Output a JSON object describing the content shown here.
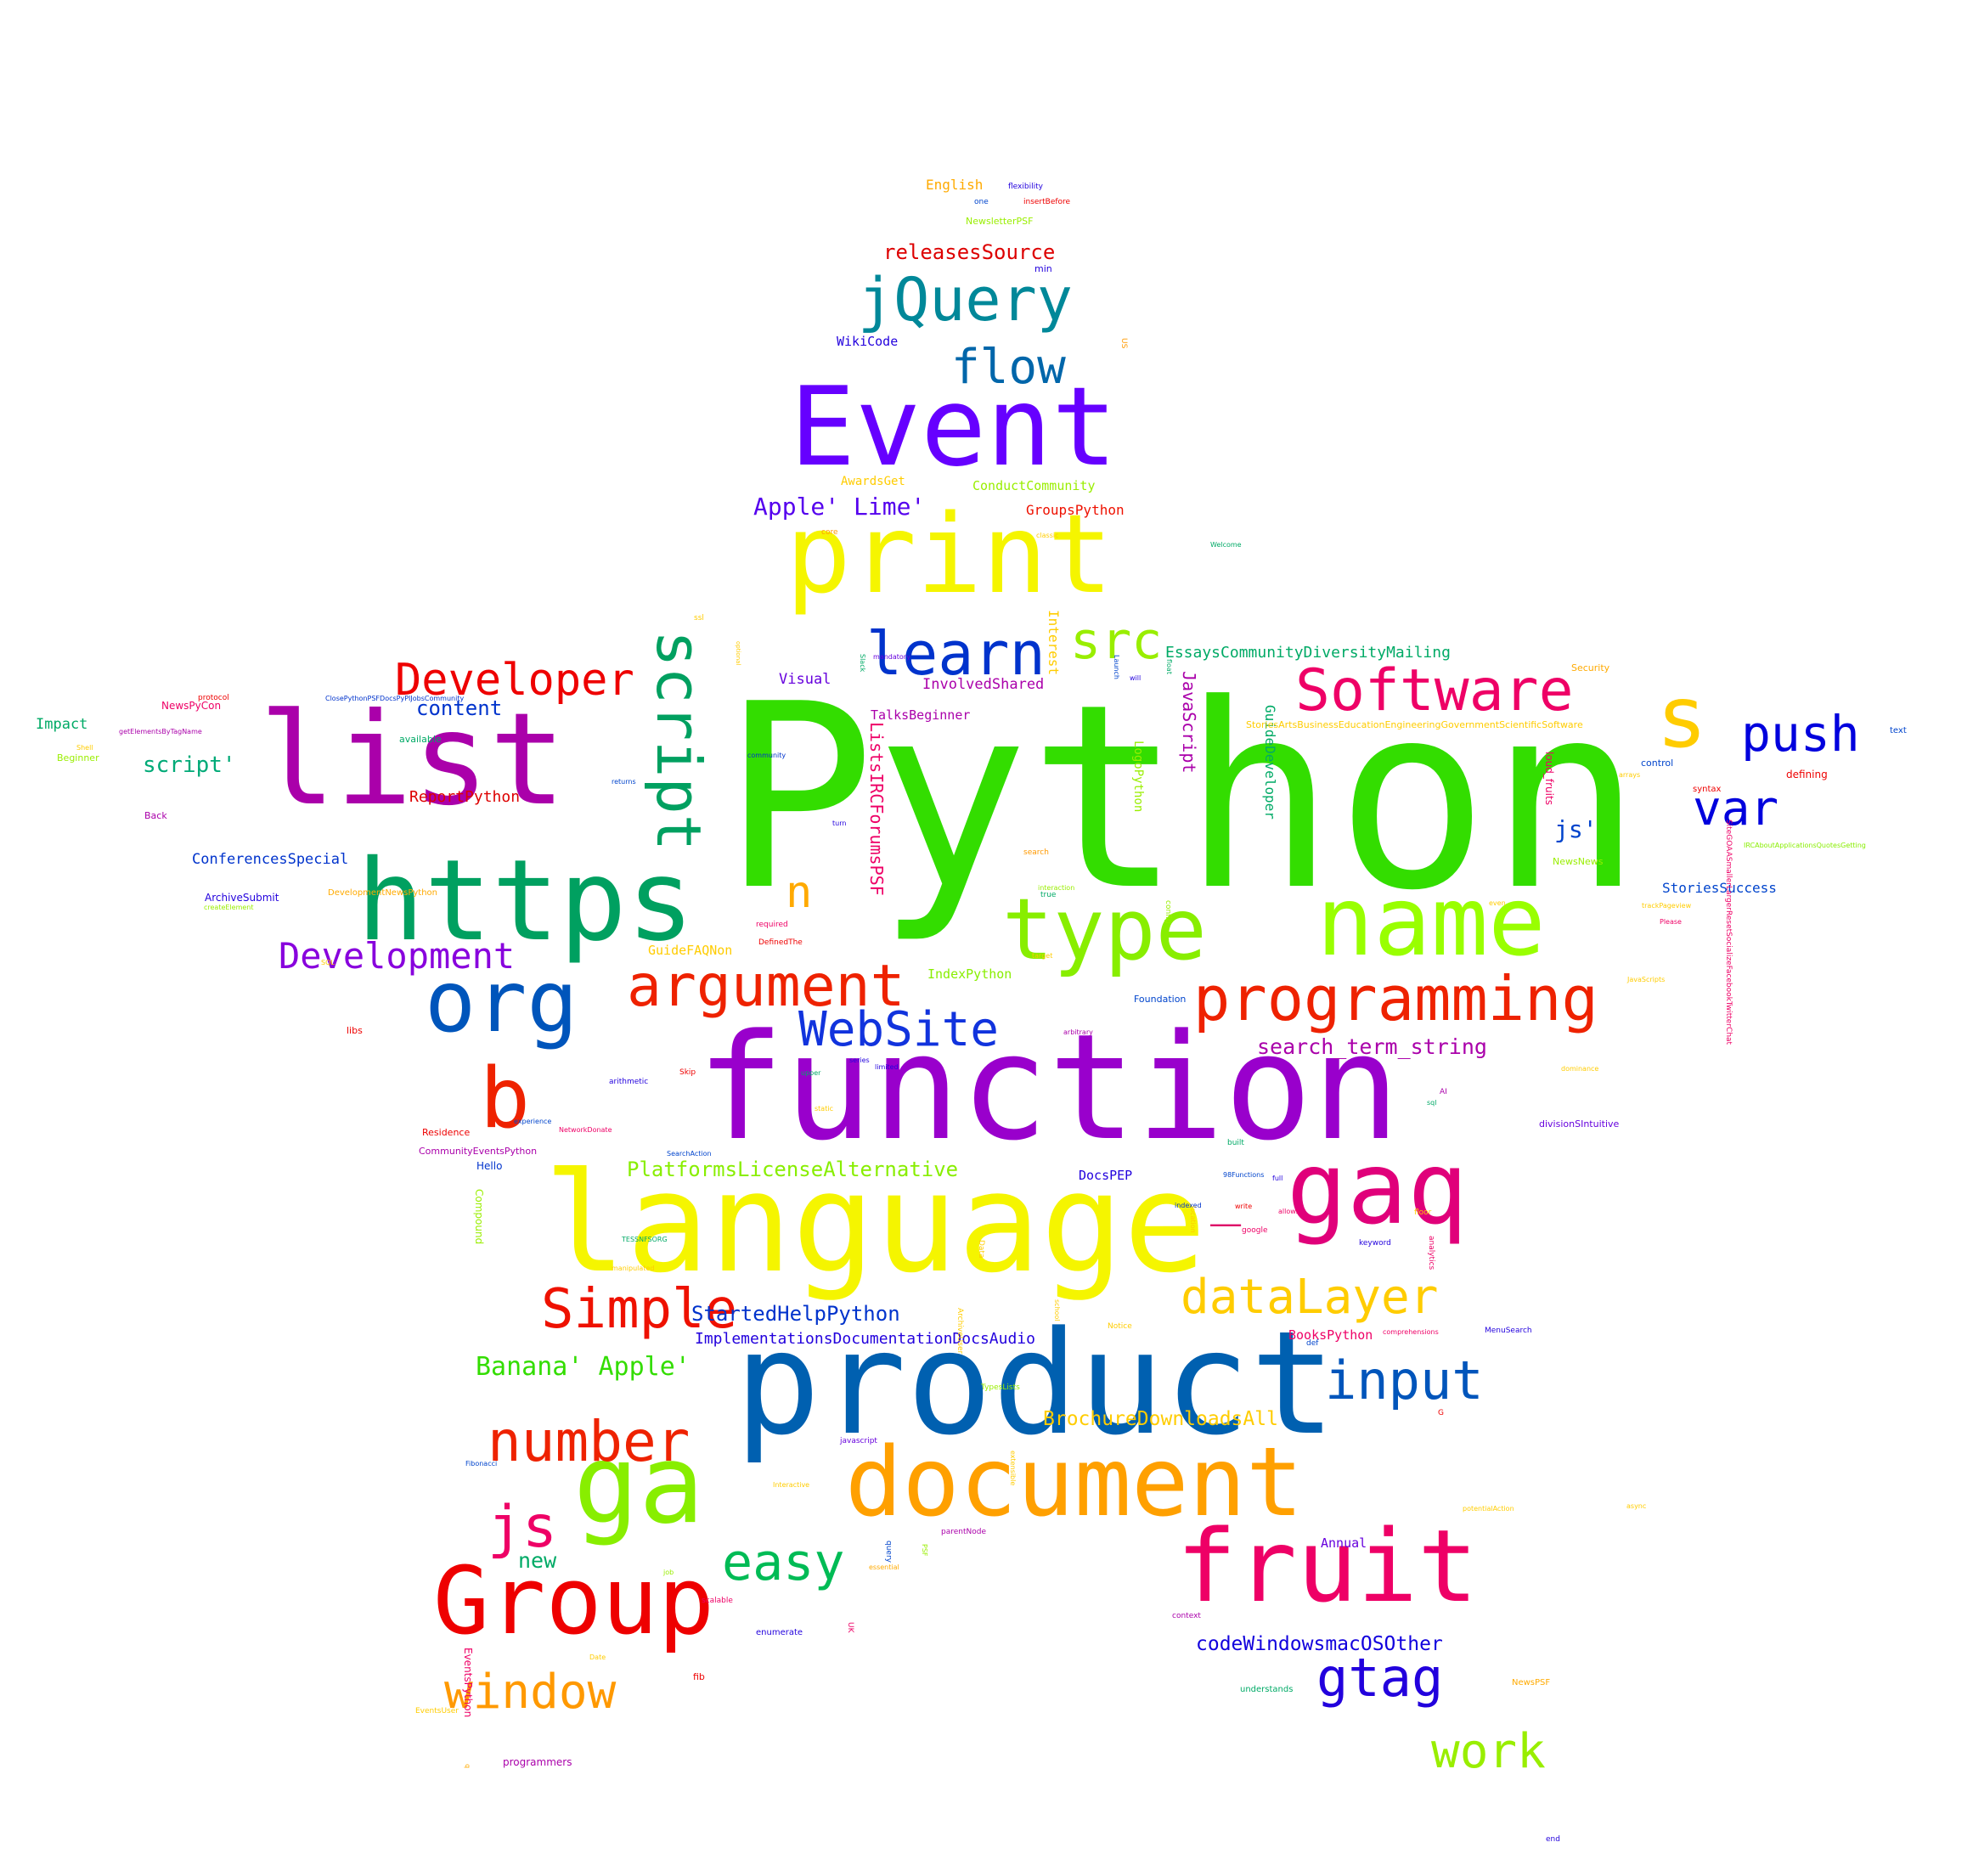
{
  "words": [
    {
      "text": "Python",
      "color": "#33dd00"
    },
    {
      "text": "function",
      "color": "#9900cc"
    },
    {
      "text": "product",
      "color": "#0060b0"
    },
    {
      "text": "language",
      "color": "#f5f500"
    },
    {
      "text": "Event",
      "color": "#6600ff"
    },
    {
      "text": "print",
      "color": "#f5f500"
    },
    {
      "text": "list",
      "color": "#aa00aa"
    },
    {
      "text": "https",
      "color": "#00a060"
    },
    {
      "text": "name",
      "color": "#99ff00"
    },
    {
      "text": "document",
      "color": "#ffa000"
    },
    {
      "text": "ga",
      "color": "#88ee00"
    },
    {
      "text": "fruit",
      "color": "#ee0066"
    },
    {
      "text": "gaq",
      "color": "#e0007a"
    },
    {
      "text": "_",
      "color": "#dd0066"
    },
    {
      "text": "Group",
      "color": "#ee0000"
    },
    {
      "text": "type",
      "color": "#88ee00"
    },
    {
      "text": "org",
      "color": "#0055bb"
    },
    {
      "text": "jQuery",
      "color": "#008899"
    },
    {
      "text": "script",
      "color": "#00a060"
    },
    {
      "text": "s",
      "color": "#ffcc00"
    },
    {
      "text": "Software",
      "color": "#ee0066"
    },
    {
      "text": "b",
      "color": "#ee2200"
    },
    {
      "text": "argument",
      "color": "#ee2200"
    },
    {
      "text": "programming",
      "color": "#ee2200"
    },
    {
      "text": "learn",
      "color": "#0033cc"
    },
    {
      "text": "flow",
      "color": "#0066aa"
    },
    {
      "text": "src",
      "color": "#99ee00"
    },
    {
      "text": "push",
      "color": "#0000dd"
    },
    {
      "text": "var",
      "color": "#0000dd"
    },
    {
      "text": "WebSite",
      "color": "#1133dd"
    },
    {
      "text": "Simple",
      "color": "#ee1100"
    },
    {
      "text": "dataLayer",
      "color": "#ffcc00"
    },
    {
      "text": "input",
      "color": "#0055bb"
    },
    {
      "text": "number",
      "color": "#ee2200"
    },
    {
      "text": "Developer",
      "color": "#ee0000"
    },
    {
      "text": "Development",
      "color": "#8800dd"
    },
    {
      "text": "js",
      "color": "#ee0066"
    },
    {
      "text": "easy",
      "color": "#00bb55"
    },
    {
      "text": "window",
      "color": "#ff9900"
    },
    {
      "text": "gtag",
      "color": "#2200dd"
    },
    {
      "text": "work",
      "color": "#99ee00"
    },
    {
      "text": "n",
      "color": "#ffaa00"
    },
    {
      "text": "releasesSource",
      "color": "#dd0000"
    },
    {
      "text": "Apple' Lime'",
      "color": "#5500ee"
    },
    {
      "text": "content",
      "color": "#0033cc"
    },
    {
      "text": "script'",
      "color": "#00aa77"
    },
    {
      "text": "ReportPython",
      "color": "#dd0000"
    },
    {
      "text": "js'",
      "color": "#0044cc"
    },
    {
      "text": "search_term_string",
      "color": "#aa00aa"
    },
    {
      "text": "PlatformsLicenseAlternative",
      "color": "#88ee00"
    },
    {
      "text": "StartedHelpPython",
      "color": "#0033cc"
    },
    {
      "text": "Banana' Apple'",
      "color": "#33dd00"
    },
    {
      "text": "BrochureDownloadsAll",
      "color": "#ffcc00"
    },
    {
      "text": "codeWindowsmacOSOther",
      "color": "#1100dd"
    },
    {
      "text": "ImplementationsDocumentationDocsAudio",
      "color": "#2200dd"
    },
    {
      "text": "new",
      "color": "#00aa66"
    },
    {
      "text": "ListsIRCForumsPSF",
      "color": "#ee0066"
    },
    {
      "text": "JavaScript",
      "color": "#aa00aa"
    },
    {
      "text": "GuideDeveloper",
      "color": "#00aa66"
    },
    {
      "text": "EssaysCommunityDiversityMailing",
      "color": "#00aa66"
    },
    {
      "text": "StoriesSuccess",
      "color": "#0044cc"
    },
    {
      "text": "English",
      "color": "#ffaa00"
    },
    {
      "text": "WikiCode",
      "color": "#2200dd"
    },
    {
      "text": "ConductCommunity",
      "color": "#99ee00"
    },
    {
      "text": "GroupsPython",
      "color": "#ee1100"
    },
    {
      "text": "AwardsGet",
      "color": "#ffcc00"
    },
    {
      "text": "Visual",
      "color": "#6600dd"
    },
    {
      "text": "InvolvedShared",
      "color": "#aa00aa"
    },
    {
      "text": "TalksBeginner",
      "color": "#aa00aa"
    },
    {
      "text": "Interest",
      "color": "#ffcc00"
    },
    {
      "text": "IndexPython",
      "color": "#88ee00"
    },
    {
      "text": "GuideFAQNon",
      "color": "#ffcc00"
    },
    {
      "text": "DocsPEP",
      "color": "#2200dd"
    },
    {
      "text": "BooksPython",
      "color": "#ee0066"
    },
    {
      "text": "Annual",
      "color": "#6600dd"
    },
    {
      "text": "Impact",
      "color": "#00aa66"
    },
    {
      "text": "ConferencesSpecial",
      "color": "#0033cc"
    },
    {
      "text": "NewsletterPSF",
      "color": "#99ee00"
    },
    {
      "text": "LogoPython",
      "color": "#99ee00"
    },
    {
      "text": "NewsPyCon",
      "color": "#ee0066"
    },
    {
      "text": "ArchiveSubmit",
      "color": "#2200dd"
    },
    {
      "text": "Beginner",
      "color": "#99ee00"
    },
    {
      "text": "available",
      "color": "#00aa66"
    },
    {
      "text": "Back",
      "color": "#aa00aa"
    },
    {
      "text": "libs",
      "color": "#ee0000"
    },
    {
      "text": "Security",
      "color": "#ffaa00"
    },
    {
      "text": "StoriesArtsBusinessEducationEngineeringGovernmentScientificSoftware",
      "color": "#ffcc00"
    },
    {
      "text": "control",
      "color": "#0044cc"
    },
    {
      "text": "defining",
      "color": "#ee0000"
    },
    {
      "text": "syntax",
      "color": "#ee0000"
    },
    {
      "text": "loud_fruits",
      "color": "#ee0066"
    },
    {
      "text": "NewsNews",
      "color": "#99ee00"
    },
    {
      "text": "Foundation",
      "color": "#0044cc"
    },
    {
      "text": "CommunityEventsPython",
      "color": "#aa00aa"
    },
    {
      "text": "Residence",
      "color": "#ee0000"
    },
    {
      "text": "Hello",
      "color": "#0033cc"
    },
    {
      "text": "divisionSIntuitive",
      "color": "#6600dd"
    },
    {
      "text": "Compound",
      "color": "#99ee00"
    },
    {
      "text": "EventsPython",
      "color": "#ee0066"
    },
    {
      "text": "programmers",
      "color": "#aa00aa"
    },
    {
      "text": "fib",
      "color": "#ee0000"
    },
    {
      "text": "enumerate",
      "color": "#2200dd"
    },
    {
      "text": "understands",
      "color": "#00aa66"
    },
    {
      "text": "NewsPSF",
      "color": "#ffaa00"
    },
    {
      "text": "end",
      "color": "#2200dd"
    },
    {
      "text": "text",
      "color": "#0044cc"
    },
    {
      "text": "min",
      "color": "#2200dd"
    },
    {
      "text": "flexibility",
      "color": "#2200dd"
    },
    {
      "text": "insertBefore",
      "color": "#ee0000"
    },
    {
      "text": "one",
      "color": "#0044cc"
    },
    {
      "text": "ssl",
      "color": "#ffcc00"
    },
    {
      "text": "protocol",
      "color": "#ee0000"
    },
    {
      "text": "getElementsByTagName",
      "color": "#aa00aa"
    },
    {
      "text": "ClosePythonPSFDocsPyPIJobsCommunity",
      "color": "#0033cc"
    },
    {
      "text": "Welcome",
      "color": "#00aa66"
    },
    {
      "text": "will",
      "color": "#2200dd"
    },
    {
      "text": "mandatory",
      "color": "#6600dd"
    },
    {
      "text": "turn",
      "color": "#2200dd"
    },
    {
      "text": "community",
      "color": "#0033cc"
    },
    {
      "text": "returns",
      "color": "#0044cc"
    },
    {
      "text": "search",
      "color": "#ff9900"
    },
    {
      "text": "interaction",
      "color": "#99ee00"
    },
    {
      "text": "true",
      "color": "#00aa66"
    },
    {
      "text": "arbitrary",
      "color": "#aa00aa"
    },
    {
      "text": "arithmetic",
      "color": "#2200dd"
    },
    {
      "text": "series",
      "color": "#2200dd"
    },
    {
      "text": "limited",
      "color": "#2200dd"
    },
    {
      "text": "experience",
      "color": "#0044cc"
    },
    {
      "text": "indexed",
      "color": "#0033cc"
    },
    {
      "text": "SearchAction",
      "color": "#0044cc"
    },
    {
      "text": "DefinedThe",
      "color": "#ee0000"
    },
    {
      "text": "required",
      "color": "#ee0066"
    },
    {
      "text": "target",
      "color": "#ffcc00"
    },
    {
      "text": "Skip",
      "color": "#ee0000"
    },
    {
      "text": "built",
      "color": "#00aa66"
    },
    {
      "text": "full",
      "color": "#2200dd"
    },
    {
      "text": "write",
      "color": "#ee0000"
    },
    {
      "text": "google",
      "color": "#ee0066"
    },
    {
      "text": "allows",
      "color": "#ee0066"
    },
    {
      "text": "keyword",
      "color": "#2200dd"
    },
    {
      "text": "MenuSearch",
      "color": "#2200dd"
    },
    {
      "text": "Please",
      "color": "#ee0066"
    },
    {
      "text": "comprehensions",
      "color": "#ee0066"
    },
    {
      "text": "parentNode",
      "color": "#aa00aa"
    },
    {
      "text": "essential",
      "color": "#ffaa00"
    },
    {
      "text": "job",
      "color": "#99ee00"
    },
    {
      "text": "scalable",
      "color": "#ee0066"
    },
    {
      "text": "context",
      "color": "#aa00aa"
    },
    {
      "text": "SiteGOAASmallerLargerResetSocializeFacebookTwitterChat",
      "color": "#ee0066"
    },
    {
      "text": "IRCAboutApplicationsQuotesGetting",
      "color": "#88ee00"
    },
    {
      "text": "Fibonacci",
      "color": "#0044cc"
    },
    {
      "text": "NetworkDonate",
      "color": "#ee0066"
    },
    {
      "text": "Data",
      "color": "#ffcc00"
    },
    {
      "text": "config",
      "color": "#99ee00"
    },
    {
      "text": "DevelopmentNewsPython",
      "color": "#ffaa00"
    },
    {
      "text": "createElement",
      "color": "#99ee00"
    },
    {
      "text": "core",
      "color": "#ff9900"
    },
    {
      "text": "javascript",
      "color": "#6600dd"
    },
    {
      "text": "potentialAction",
      "color": "#ffcc00"
    },
    {
      "text": "query",
      "color": "#0044cc"
    },
    {
      "text": "Notice",
      "color": "#ffcc00"
    },
    {
      "text": "TypesLists",
      "color": "#99ee00"
    },
    {
      "text": "ArchiveUser",
      "color": "#ffcc00"
    },
    {
      "text": "EventsUser",
      "color": "#ffcc00"
    },
    {
      "text": "Date",
      "color": "#ffcc00"
    },
    {
      "text": "G",
      "color": "#ee0000"
    },
    {
      "text": "def",
      "color": "#0044cc"
    },
    {
      "text": "upper",
      "color": "#00aa66"
    },
    {
      "text": "static",
      "color": "#ffcc00"
    },
    {
      "text": "school",
      "color": "#ffcc00"
    },
    {
      "text": "manipulated",
      "color": "#ffcc00"
    },
    {
      "text": "AI",
      "color": "#aa00aa"
    },
    {
      "text": "PSF",
      "color": "#99ee00"
    },
    {
      "text": "UK",
      "color": "#ee0066"
    },
    {
      "text": "US",
      "color": "#ff9900"
    },
    {
      "text": "analytics",
      "color": "#ee0066"
    },
    {
      "text": "Slack",
      "color": "#00aa66"
    },
    {
      "text": "float",
      "color": "#00aa66"
    },
    {
      "text": "Launch",
      "color": "#0044cc"
    },
    {
      "text": "optional",
      "color": "#ffcc00"
    },
    {
      "text": "Shell",
      "color": "#ffcc00"
    },
    {
      "text": "SQL",
      "color": "#ffcc00"
    },
    {
      "text": "TESSNFSORG",
      "color": "#00aa66"
    },
    {
      "text": "trackPageview",
      "color": "#ffcc00"
    },
    {
      "text": "JavaScripts",
      "color": "#ffcc00"
    },
    {
      "text": "dominance",
      "color": "#ffcc00"
    },
    {
      "text": "arrays",
      "color": "#ffcc00"
    },
    {
      "text": "location",
      "color": "#ffcc00"
    },
    {
      "text": "classic",
      "color": "#ffcc00"
    },
    {
      "text": "async",
      "color": "#ffcc00"
    },
    {
      "text": "even",
      "color": "#ffcc00"
    },
    {
      "text": "sql",
      "color": "#00aa66"
    },
    {
      "text": "floor",
      "color": "#ffcc00"
    },
    {
      "text": "Interactive",
      "color": "#ffcc00"
    },
    {
      "text": "98Functions",
      "color": "#0044cc"
    },
    {
      "text": "extensible",
      "color": "#ffcc00"
    },
    {
      "text": "q",
      "color": "#ffaa00"
    }
  ]
}
